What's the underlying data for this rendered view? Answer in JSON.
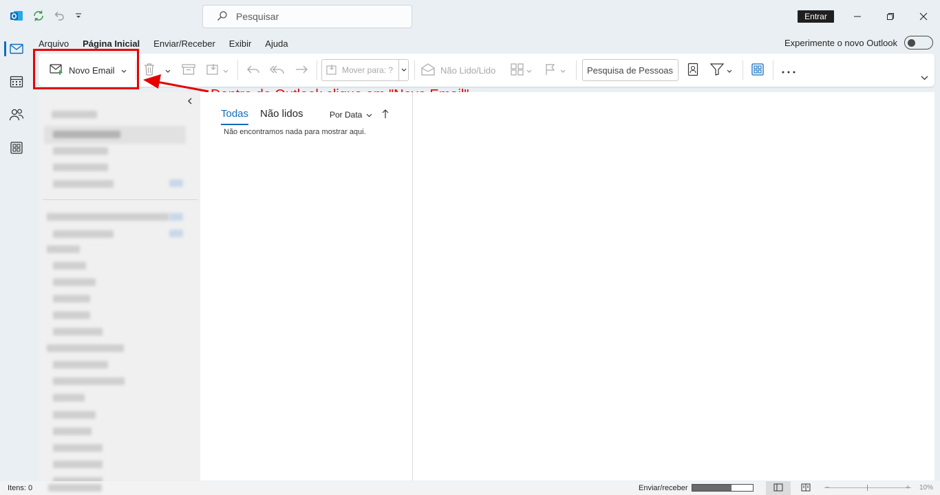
{
  "titlebar": {
    "search_placeholder": "Pesquisar",
    "sign_in_label": "Entrar"
  },
  "menu": {
    "tabs": [
      "Arquivo",
      "Página Inicial",
      "Enviar/Receber",
      "Exibir",
      "Ajuda"
    ],
    "active_tab": "Página Inicial",
    "try_new_label": "Experimente o novo Outlook"
  },
  "ribbon": {
    "new_email_label": "Novo Email",
    "move_to_label": "Mover para: ?",
    "read_unread_label": "Não Lido/Lido",
    "people_search_placeholder": "Pesquisa de Pessoas"
  },
  "annotation": {
    "text": "Dentro do Outlook clique em \"Novo Email\"",
    "color": "#e60000"
  },
  "message_list": {
    "tabs": [
      "Todas",
      "Não lidos"
    ],
    "sort_label": "Por Data",
    "empty_message": "Não encontramos nada para mostrar aqui."
  },
  "statusbar": {
    "items_label": "Itens: 0",
    "send_receive_label": "Enviar/receber",
    "send_receive_progress": 0.65,
    "zoom_label": "10%"
  },
  "colors": {
    "accent": "#0f6cbd",
    "annotation": "#e60000"
  },
  "icons": [
    "outlook-logo-icon",
    "sync-icon",
    "undo-icon",
    "quick-access-dropdown-icon",
    "search-icon",
    "mail-icon",
    "calendar-icon",
    "people-icon",
    "apps-icon",
    "new-mail-icon",
    "delete-icon",
    "archive-icon",
    "move-icon",
    "reply-icon",
    "reply-all-icon",
    "forward-icon",
    "envelope-open-icon",
    "categorize-icon",
    "flag-icon",
    "address-book-icon",
    "filter-icon",
    "grid-view-icon",
    "more-icon"
  ]
}
